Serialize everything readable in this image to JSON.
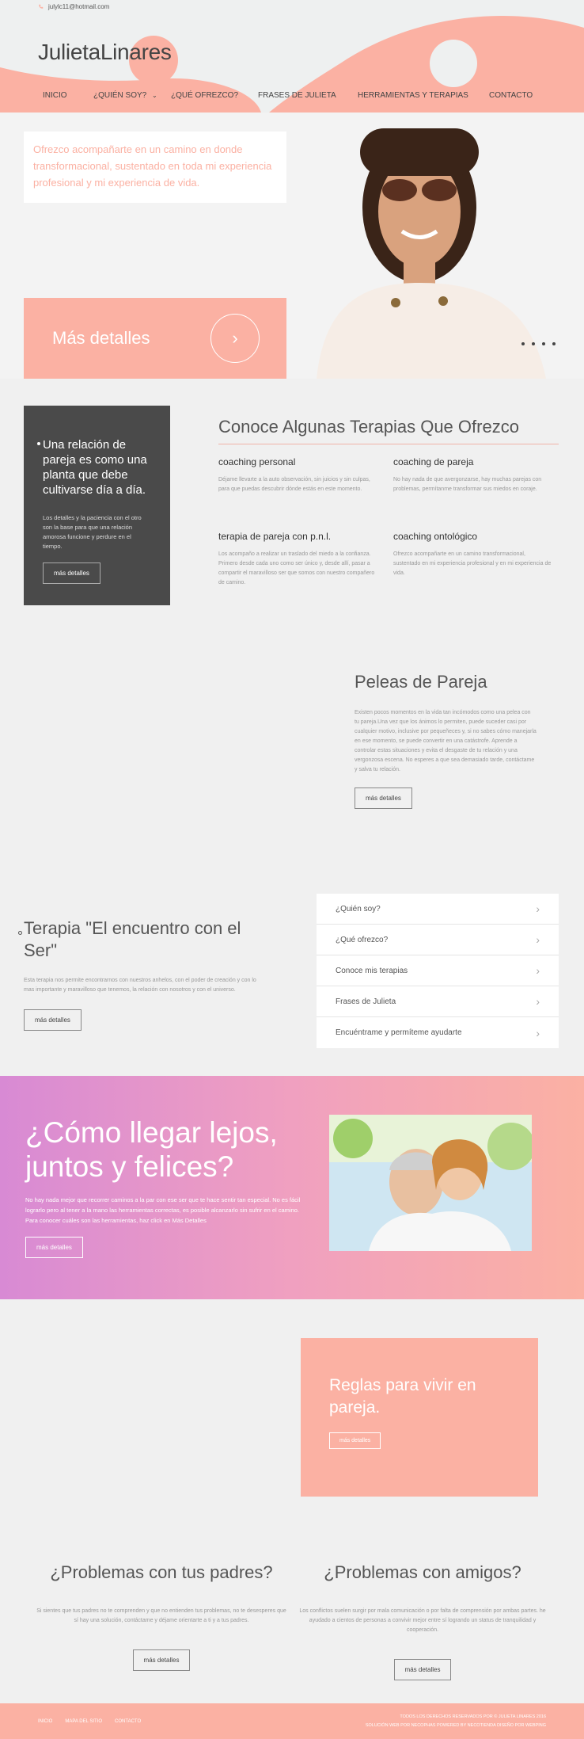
{
  "header": {
    "email": "julylc11@hotmail.com",
    "logo": "JulietaLinares",
    "nav": [
      {
        "label": "INICIO"
      },
      {
        "label": "¿QUIÉN SOY?"
      },
      {
        "label": "¿QUÉ OFREZCO?"
      },
      {
        "label": "FRASES DE JULIETA"
      },
      {
        "label": "HERRAMIENTAS Y TERAPIAS"
      },
      {
        "label": "CONTACTO"
      }
    ]
  },
  "hero": {
    "text": "Ofrezco acompañarte en un camino en donde transformacional, sustentado en toda mi experiencia profesional y mi experiencia de vida.",
    "cta": "Más detalles",
    "arrow": "›"
  },
  "card": {
    "title": "Una relación de pareja es como una planta que debe cultivarse día a día.",
    "text": "Los detalles y la paciencia con el otro son la base para que una relación amorosa funcione y perdure en el tiempo.",
    "button": "más detalles"
  },
  "terapias": {
    "title": "Conoce Algunas Terapias Que Ofrezco",
    "items": [
      {
        "title": "coaching personal",
        "text": "Déjame llevarte a la auto observación, sin juicios y sin culpas, para que puedas descubrir dónde estás en este momento."
      },
      {
        "title": "coaching de pareja",
        "text": "No hay nada de que avergonzarse, hay muchas parejas con problemas, permítanme transformar sus miedos en coraje."
      },
      {
        "title": "terapia de pareja con p.n.l.",
        "text": "Los acompaño a realizar un traslado del miedo a la confianza. Primero desde cada uno como ser único y, desde allí, pasar a compartir el maravilloso ser que somos con nuestro compañero de camino."
      },
      {
        "title": "coaching ontológico",
        "text": "Ofrezco acompañarte en un camino transformacional, sustentado en mi experiencia profesional y en mi experiencia de vida."
      }
    ]
  },
  "peleas": {
    "title": "Peleas de Pareja",
    "text": "Existen pocos momentos en la vida tan incómodos como una pelea con tu pareja.Una vez que los ánimos lo permiten, puede suceder casi por cualquier motivo, inclusive por pequeñeces y, si no sabes cómo manejarla en ese momento, se puede convertir en una catástrofe. Aprende a controlar estas situaciones y evita el desgaste de tu relación y una vergonzosa escena. No esperes a que sea demasiado tarde, contáctame y salva tu relación.",
    "button": "más detalles"
  },
  "encuentro": {
    "title": "Terapia \"El encuentro con el Ser\"",
    "text": "Esta terapia nos permite encontrarnos con nuestros anhelos, con el poder de creación y con lo mas importante y maravilloso que tenemos, la relación con nosotros y con el universo.",
    "button": "más detalles",
    "menu": [
      {
        "label": "¿Quién soy?"
      },
      {
        "label": "¿Qué ofrezco?"
      },
      {
        "label": "Conoce mis terapias"
      },
      {
        "label": "Frases de Julieta"
      },
      {
        "label": "Encuéntrame y permíteme ayudarte"
      }
    ]
  },
  "lejos": {
    "title": "¿Cómo llegar lejos, juntos y felices?",
    "text": "No hay nada mejor que recorrer caminos a la par con ese ser que te hace sentir tan especial. No es fácil lograrlo pero al tener a la mano las herramientas correctas, es posible alcanzarlo sin sufrir en el camino. Para conocer cuáles son las herramientas, haz click en Más Detalles",
    "button": "más detalles"
  },
  "reglas": {
    "title": "Reglas para vivir en pareja.",
    "button": "más detalles"
  },
  "padres": {
    "title": "¿Problemas con tus padres?",
    "text": "Si sientes que tus padres no te comprenden y que no entienden tus problemas, no te desesperes que sí hay una solución, contáctame y déjame orientarte a ti y a tus padres.",
    "button": "más detalles"
  },
  "amigos": {
    "title": "¿Problemas con amigos?",
    "text": "Los conflictos suelen surgir por mala comunicación o por falta de comprensión por ambas partes. he ayudado a cientos de personas a convivir mejor entre sí logrando un status de tranquilidad y cooperación.",
    "button": "más detalles"
  },
  "footer": {
    "links": [
      {
        "label": "INICIO"
      },
      {
        "label": "MAPA DEL SITIO"
      },
      {
        "label": "CONTACTO"
      }
    ],
    "copy1": "TODOS LOS DERECHOS RESERVADOS POR © JULIETA LINARES 2016",
    "copy2": "SOLUCIÓN WEB POR NECOPHAS POWERED BY NECOTIENDA DISEÑO POR WEBPING"
  },
  "colors": {
    "accent": "#fbb1a3",
    "dark": "#4a4a4a",
    "gradient_start": "#d88ad4"
  },
  "icons": [
    "phone-icon",
    "chevron-down-icon",
    "chevron-right-icon"
  ]
}
